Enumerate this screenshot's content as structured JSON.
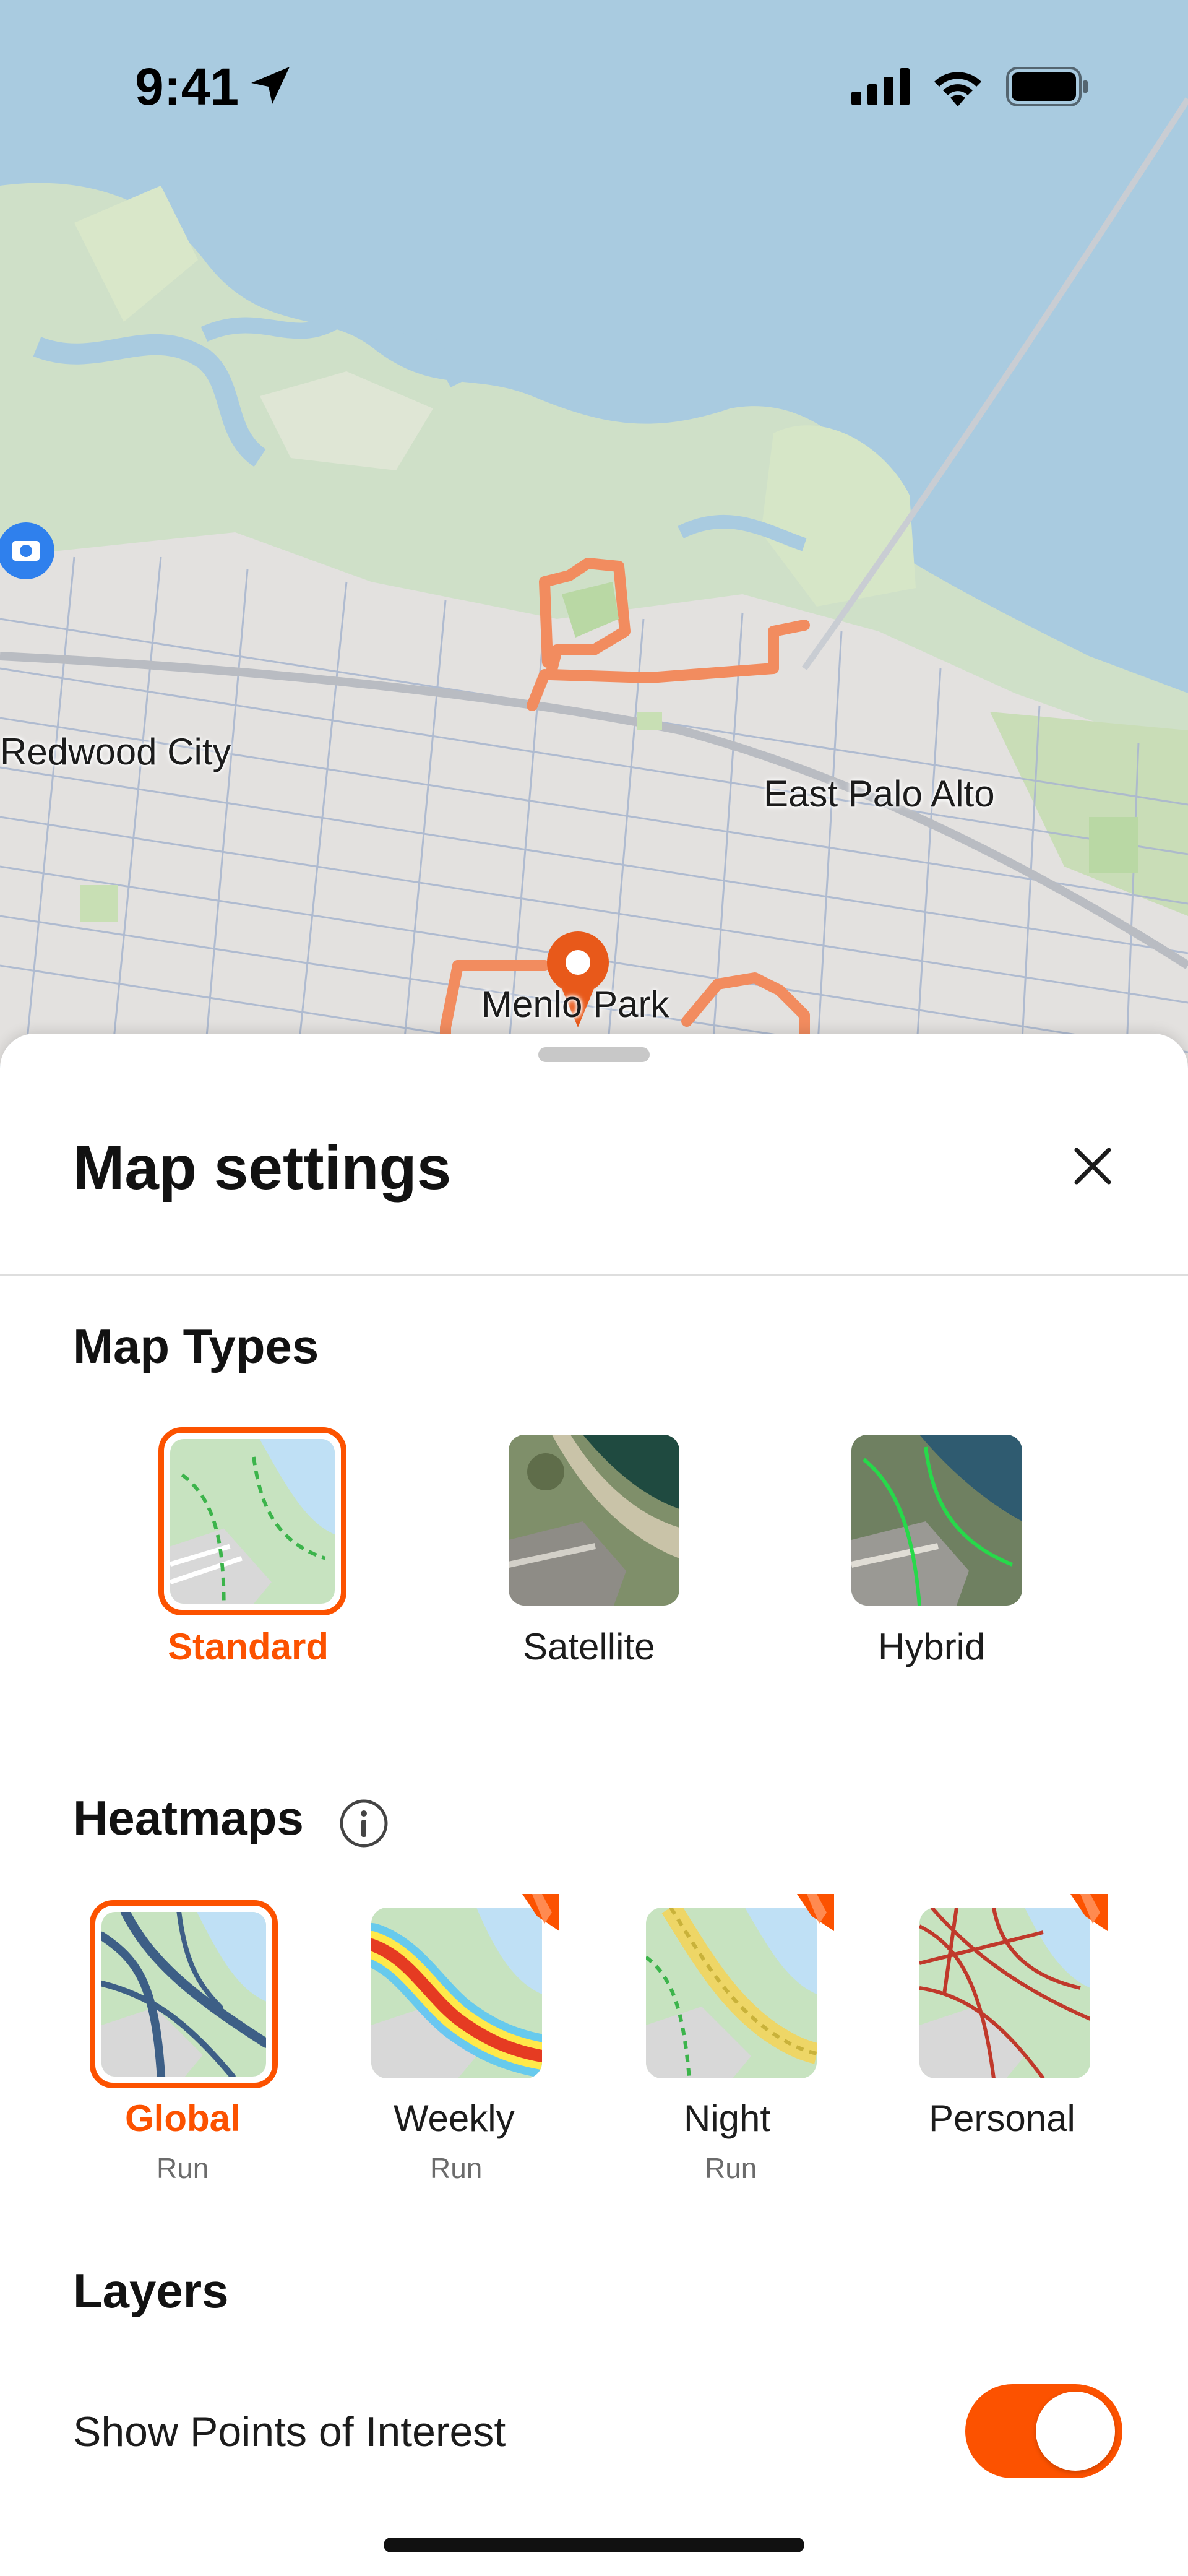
{
  "status_bar": {
    "time": "9:41"
  },
  "map": {
    "places": [
      "Redwood City",
      "East Palo Alto",
      "Menlo Park"
    ],
    "route_color": "#fc5200",
    "water_color": "#a9cbe0",
    "land_color": "#e3e1df"
  },
  "sheet": {
    "title": "Map settings",
    "map_types": {
      "title": "Map Types",
      "items": [
        {
          "label": "Standard",
          "selected": true
        },
        {
          "label": "Satellite",
          "selected": false
        },
        {
          "label": "Hybrid",
          "selected": false
        }
      ]
    },
    "heatmaps": {
      "title": "Heatmaps",
      "items": [
        {
          "label": "Global",
          "sublabel": "Run",
          "selected": true,
          "premium": false
        },
        {
          "label": "Weekly",
          "sublabel": "Run",
          "selected": false,
          "premium": true
        },
        {
          "label": "Night",
          "sublabel": "Run",
          "selected": false,
          "premium": true
        },
        {
          "label": "Personal",
          "sublabel": "",
          "selected": false,
          "premium": true
        }
      ]
    },
    "layers": {
      "title": "Layers",
      "poi_label": "Show Points of Interest",
      "poi_enabled": true
    },
    "accent_color": "#fc5200"
  }
}
